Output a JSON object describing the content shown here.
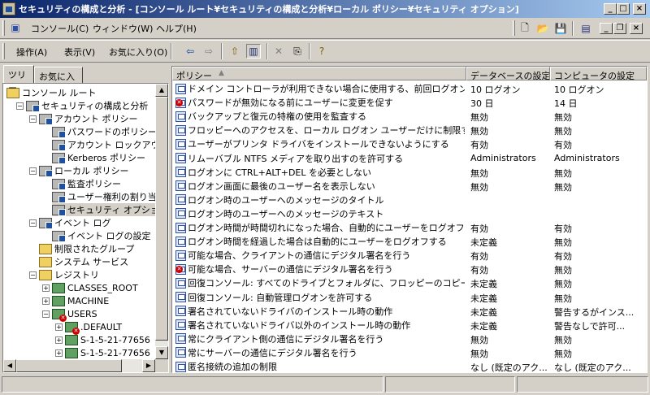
{
  "window": {
    "title": "セキュリティの構成と分析 - [コンソール ルート¥セキュリティの構成と分析¥ローカル ポリシー¥セキュリティ オプション]"
  },
  "title_buttons": {
    "minimize": "_",
    "maximize": "□",
    "close": "×"
  },
  "mdi_buttons": {
    "minimize": "_",
    "restore": "❐",
    "close": "×"
  },
  "menu": {
    "items": [
      "コンソール(C)",
      "ウィンドウ(W)",
      "ヘルプ(H)"
    ]
  },
  "actionbar": {
    "items": [
      "操作(A)",
      "表示(V)",
      "お気に入り(O)"
    ]
  },
  "tabs": [
    "ツリー",
    "お気に入り"
  ],
  "tree": [
    {
      "label": "コンソール ルート",
      "icon": "folder",
      "level": 0
    },
    {
      "label": "セキュリティの構成と分析",
      "icon": "security",
      "level": 1,
      "toggle": "−"
    },
    {
      "label": "アカウント ポリシー",
      "icon": "security",
      "level": 2,
      "toggle": "−"
    },
    {
      "label": "パスワードのポリシー",
      "icon": "security",
      "level": 3
    },
    {
      "label": "アカウント ロックアウトの",
      "icon": "security",
      "level": 3
    },
    {
      "label": "Kerberos ポリシー",
      "icon": "security",
      "level": 3
    },
    {
      "label": "ローカル ポリシー",
      "icon": "security",
      "level": 2,
      "toggle": "−"
    },
    {
      "label": "監査ポリシー",
      "icon": "security",
      "level": 3
    },
    {
      "label": "ユーザー権利の割り当",
      "icon": "security",
      "level": 3
    },
    {
      "label": "セキュリティ オプション",
      "icon": "security",
      "level": 3,
      "selected": true
    },
    {
      "label": "イベント ログ",
      "icon": "security",
      "level": 2,
      "toggle": "−"
    },
    {
      "label": "イベント ログの設定",
      "icon": "security",
      "level": 3
    },
    {
      "label": "制限されたグループ",
      "icon": "folder",
      "level": 2
    },
    {
      "label": "システム サービス",
      "icon": "folder",
      "level": 2
    },
    {
      "label": "レジストリ",
      "icon": "folder",
      "level": 2,
      "toggle": "−"
    },
    {
      "label": "CLASSES_ROOT",
      "icon": "registry",
      "level": 3,
      "toggle": "+"
    },
    {
      "label": "MACHINE",
      "icon": "registry",
      "level": 3,
      "toggle": "+"
    },
    {
      "label": "USERS",
      "icon": "registry-error",
      "level": 3,
      "toggle": "−"
    },
    {
      "label": ".DEFAULT",
      "icon": "registry-error",
      "level": 4,
      "toggle": "+"
    },
    {
      "label": "S-1-5-21-77656",
      "icon": "registry",
      "level": 4,
      "toggle": "+"
    },
    {
      "label": "S-1-5-21-77656",
      "icon": "registry",
      "level": 4,
      "toggle": "+"
    }
  ],
  "list": {
    "columns": [
      "ポリシー",
      "データベースの設定",
      "コンピュータの設定"
    ],
    "sort_arrow": "▲",
    "rows": [
      {
        "policy": "ドメイン コントローラが利用できない場合に使用する、前回ログオンのキ...",
        "db": "10 ログオン",
        "pc": "10 ログオン",
        "status": "ok"
      },
      {
        "policy": "パスワードが無効になる前にユーザーに変更を促す",
        "db": "30 日",
        "pc": "14 日",
        "status": "mismatch"
      },
      {
        "policy": "バックアップと復元の特権の使用を監査する",
        "db": "無効",
        "pc": "無効",
        "status": "ok"
      },
      {
        "policy": "フロッピーへのアクセスを、ローカル ログオン ユーザーだけに制限する",
        "db": "無効",
        "pc": "無効",
        "status": "ok"
      },
      {
        "policy": "ユーザーがプリンタ ドライバをインストールできないようにする",
        "db": "有効",
        "pc": "有効",
        "status": "ok"
      },
      {
        "policy": "リムーバブル NTFS メディアを取り出すのを許可する",
        "db": "Administrators",
        "pc": "Administrators",
        "status": "ok"
      },
      {
        "policy": "ログオンに CTRL+ALT+DEL を必要としない",
        "db": "無効",
        "pc": "無効",
        "status": "ok"
      },
      {
        "policy": "ログオン画面に最後のユーザー名を表示しない",
        "db": "無効",
        "pc": "無効",
        "status": "ok"
      },
      {
        "policy": "ログオン時のユーザーへのメッセージのタイトル",
        "db": "",
        "pc": "",
        "status": "ok"
      },
      {
        "policy": "ログオン時のユーザーへのメッセージのテキスト",
        "db": "",
        "pc": "",
        "status": "ok"
      },
      {
        "policy": "ログオン時間が時間切れになった場合、自動的にユーザーをログオフする...",
        "db": "有効",
        "pc": "有効",
        "status": "ok"
      },
      {
        "policy": "ログオン時間を経過した場合は自動的にユーザーをログオフする",
        "db": "未定義",
        "pc": "無効",
        "status": "ok"
      },
      {
        "policy": "可能な場合、クライアントの通信にデジタル署名を行う",
        "db": "有効",
        "pc": "有効",
        "status": "ok"
      },
      {
        "policy": "可能な場合、サーバーの通信にデジタル署名を行う",
        "db": "有効",
        "pc": "無効",
        "status": "mismatch"
      },
      {
        "policy": "回復コンソール: すべてのドライブとフォルダに、フロッピーのコピーとアクセ...",
        "db": "未定義",
        "pc": "無効",
        "status": "ok"
      },
      {
        "policy": "回復コンソール: 自動管理ログオンを許可する",
        "db": "未定義",
        "pc": "無効",
        "status": "ok"
      },
      {
        "policy": "署名されていないドライバのインストール時の動作",
        "db": "未定義",
        "pc": "警告するがインス...",
        "status": "ok"
      },
      {
        "policy": "署名されていないドライバ以外のインストール時の動作",
        "db": "未定義",
        "pc": "警告なしで許可...",
        "status": "ok"
      },
      {
        "policy": "常にクライアント側の通信にデジタル署名を行う",
        "db": "無効",
        "pc": "無効",
        "status": "ok"
      },
      {
        "policy": "常にサーバーの通信にデジタル署名を行う",
        "db": "無効",
        "pc": "無効",
        "status": "ok"
      },
      {
        "policy": "匿名接続の追加の制限",
        "db": "なし (既定のアク...",
        "pc": "なし (既定のアク...",
        "status": "ok"
      }
    ]
  },
  "colors": {
    "titlebar_start": "#0a246a",
    "titlebar_end": "#a6caf0",
    "face": "#d4d0c8",
    "error": "#d00000"
  }
}
